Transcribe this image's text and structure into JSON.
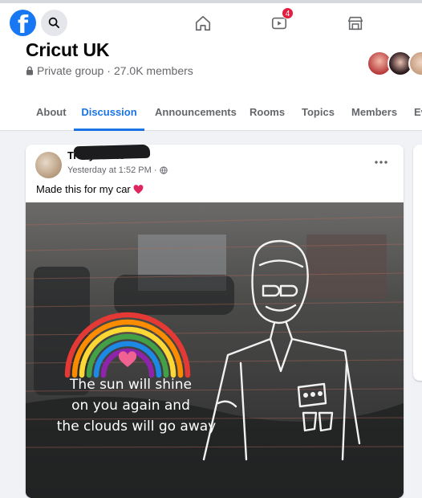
{
  "topbar": {
    "logo_letter": "f",
    "nav": [
      {
        "name": "home"
      },
      {
        "name": "watch",
        "badge": "4"
      },
      {
        "name": "marketplace"
      }
    ]
  },
  "group": {
    "name": "Cricut UK",
    "privacy": "Private group",
    "separator": "·",
    "members": "27.0K members"
  },
  "tabs": [
    "About",
    "Discussion",
    "Announcements",
    "Rooms",
    "Topics",
    "Members",
    "Ev"
  ],
  "active_tab": "Discussion",
  "post": {
    "author": "Tracy Marie",
    "timestamp": "Yesterday at 1:52 PM ·",
    "text": "Made this for my car",
    "emoji": "❤️",
    "image_caption_lines": [
      "The sun will shine",
      "on you again and",
      "the clouds will go away"
    ]
  },
  "colors": {
    "brand": "#1877f2",
    "active_tab": "#1b74e4",
    "badge": "#e41e3f",
    "rainbow": [
      "#e53935",
      "#fb8c00",
      "#fdd835",
      "#43a047",
      "#1e88e5",
      "#8e24aa"
    ]
  }
}
